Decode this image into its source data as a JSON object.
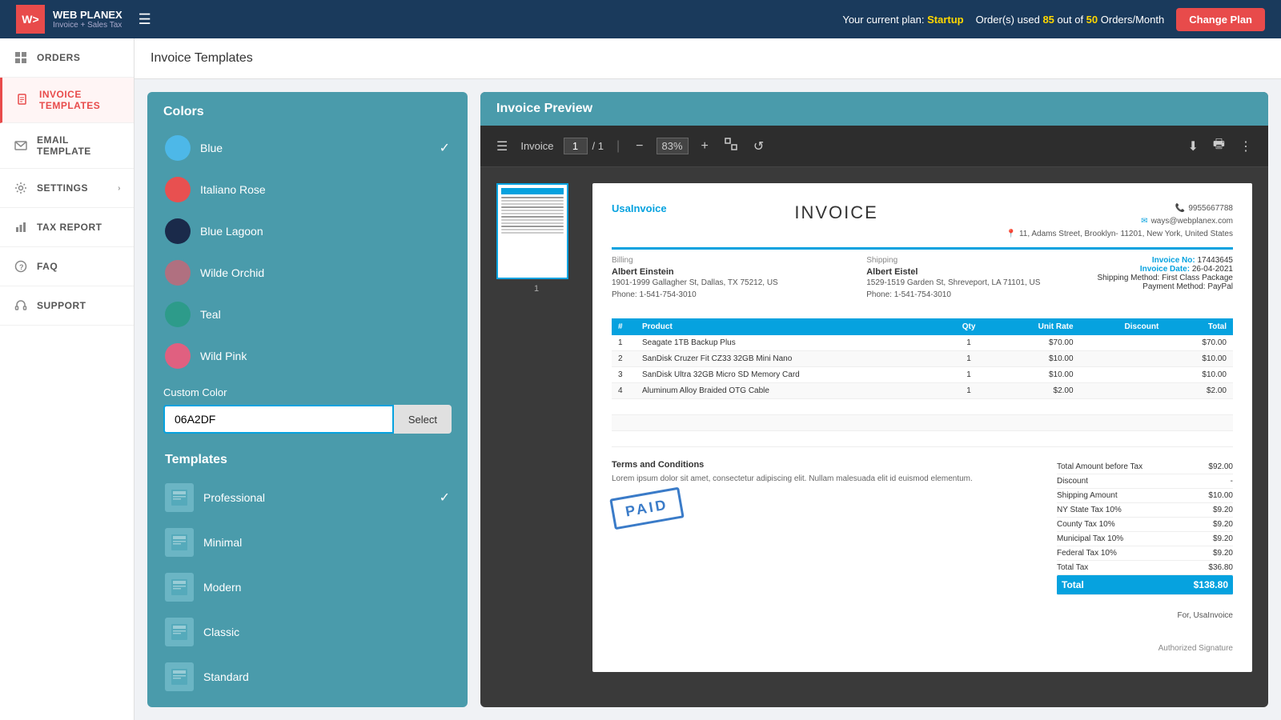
{
  "header": {
    "logo_initials": "W>",
    "logo_name": "WEB PLANEX",
    "logo_sub": "Invoice + Sales Tax",
    "plan_label": "Your current plan:",
    "plan_name": "Startup",
    "orders_label": "Order(s) used",
    "orders_used": "85",
    "orders_total": "50",
    "orders_unit": "Orders/Month",
    "change_plan_btn": "Change Plan"
  },
  "sidebar": {
    "items": [
      {
        "id": "orders",
        "label": "ORDERS",
        "icon": "grid"
      },
      {
        "id": "invoice-templates",
        "label": "INVOICE TEMPLATES",
        "icon": "file-text",
        "active": true
      },
      {
        "id": "email-template",
        "label": "EMAIL TEMPLATE",
        "icon": "mail"
      },
      {
        "id": "settings",
        "label": "SETTINGS",
        "icon": "settings",
        "has_arrow": true
      },
      {
        "id": "tax-report",
        "label": "TAX REPORT",
        "icon": "bar-chart"
      },
      {
        "id": "faq",
        "label": "FAQ",
        "icon": "help-circle"
      },
      {
        "id": "support",
        "label": "SUPPORT",
        "icon": "headphones"
      }
    ]
  },
  "page_title": "Invoice Templates",
  "left_panel": {
    "colors_title": "Colors",
    "colors": [
      {
        "id": "blue",
        "label": "Blue",
        "hex": "#4db8e8",
        "selected": true
      },
      {
        "id": "italiano-rose",
        "label": "Italiano Rose",
        "hex": "#e85050"
      },
      {
        "id": "blue-lagoon",
        "label": "Blue Lagoon",
        "hex": "#1a2a4a"
      },
      {
        "id": "wilde-orchid",
        "label": "Wilde Orchid",
        "hex": "#b07080"
      },
      {
        "id": "teal",
        "label": "Teal",
        "hex": "#2d9b8a"
      },
      {
        "id": "wild-pink",
        "label": "Wild Pink",
        "hex": "#e06080"
      }
    ],
    "custom_color_label": "Custom Color",
    "custom_color_value": "06A2DF",
    "select_btn": "Select",
    "templates_title": "Templates",
    "templates": [
      {
        "id": "professional",
        "label": "Professional",
        "selected": true
      },
      {
        "id": "minimal",
        "label": "Minimal"
      },
      {
        "id": "modern",
        "label": "Modern"
      },
      {
        "id": "classic",
        "label": "Classic"
      },
      {
        "id": "standard",
        "label": "Standard"
      }
    ]
  },
  "right_panel": {
    "title": "Invoice Preview",
    "toolbar": {
      "page_label": "Invoice",
      "page_current": "1",
      "page_total": "1",
      "zoom": "83%",
      "zoom_value": "83"
    },
    "invoice": {
      "logo": "UsaInvoice",
      "title": "INVOICE",
      "phone": "9955667788",
      "email": "ways@webplanex.com",
      "address": "11, Adams Street, Brooklyn- 11201, New York, United States",
      "billing_label": "Billing",
      "billing_name": "Albert Einstein",
      "billing_address": "1901-1999 Gallagher St, Dallas, TX 75212, US",
      "billing_phone": "Phone: 1-541-754-3010",
      "shipping_label": "Shipping",
      "shipping_name": "Albert Eistel",
      "shipping_address": "1529-1519 Garden St, Shreveport, LA 71101, US",
      "shipping_phone": "Phone: 1-541-754-3010",
      "invoice_no_label": "Invoice No:",
      "invoice_no": "17443645",
      "invoice_date_label": "Invoice Date:",
      "invoice_date": "26-04-2021",
      "shipping_method_label": "Shipping Method:",
      "shipping_method": "First Class Package",
      "payment_method_label": "Payment Method:",
      "payment_method": "PayPal",
      "table_headers": [
        "#",
        "Product",
        "Qty",
        "Unit Rate",
        "Discount",
        "Total"
      ],
      "table_rows": [
        {
          "num": "1",
          "product": "Seagate 1TB Backup Plus",
          "qty": "1",
          "unit_rate": "$70.00",
          "discount": "",
          "total": "$70.00"
        },
        {
          "num": "2",
          "product": "SanDisk Cruzer Fit CZ33 32GB Mini Nano",
          "qty": "1",
          "unit_rate": "$10.00",
          "discount": "",
          "total": "$10.00"
        },
        {
          "num": "3",
          "product": "SanDisk Ultra 32GB Micro SD Memory Card",
          "qty": "1",
          "unit_rate": "$10.00",
          "discount": "",
          "total": "$10.00"
        },
        {
          "num": "4",
          "product": "Aluminum Alloy Braided OTG Cable",
          "qty": "1",
          "unit_rate": "$2.00",
          "discount": "",
          "total": "$2.00"
        }
      ],
      "terms_label": "Terms and Conditions",
      "terms_text": "Lorem ipsum dolor sit amet, consectetur adipiscing elit. Nullam malesuada elit id euismod elementum.",
      "paid_stamp": "PAID",
      "totals": [
        {
          "label": "Total Amount before Tax",
          "value": "$92.00"
        },
        {
          "label": "Discount",
          "value": "-"
        },
        {
          "label": "Shipping Amount",
          "value": "$10.00"
        },
        {
          "label": "NY State Tax 10%",
          "value": "$9.20"
        },
        {
          "label": "County Tax 10%",
          "value": "$9.20"
        },
        {
          "label": "Municipal Tax 10%",
          "value": "$9.20"
        },
        {
          "label": "Federal Tax 10%",
          "value": "$9.20"
        },
        {
          "label": "Total Tax",
          "value": "$36.80"
        }
      ],
      "grand_total_label": "Total",
      "grand_total": "$138.80",
      "signature_for": "For, UsaInvoice",
      "signature_label": "Authorized Signature"
    }
  }
}
